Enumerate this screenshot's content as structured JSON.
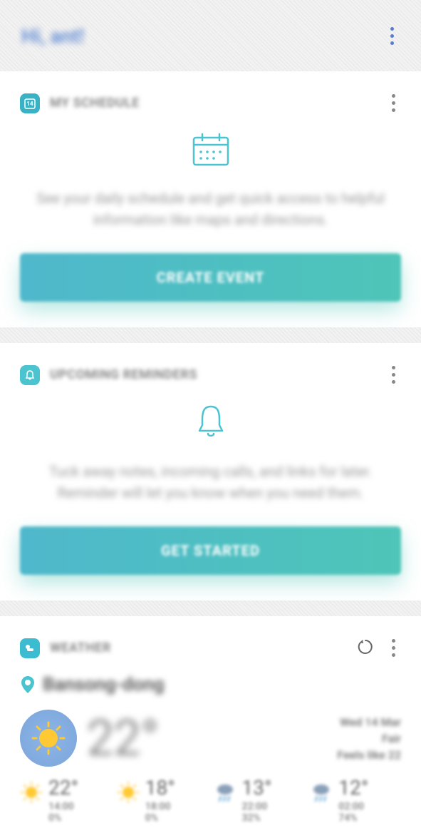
{
  "header": {
    "greeting": "Hi, ant!"
  },
  "schedule": {
    "title": "MY SCHEDULE",
    "description": "See your daily schedule and get quick access to helpful information like maps and directions.",
    "button": "CREATE EVENT"
  },
  "reminders": {
    "title": "UPCOMING REMINDERS",
    "description": "Tuck away notes, incoming calls, and links for later. Reminder will let you know when you need them.",
    "button": "GET STARTED"
  },
  "weather": {
    "title": "WEATHER",
    "location": "Bansong-dong",
    "current_temp": "22°",
    "date": "Wed 14 Mar",
    "condition": "Fair",
    "feels_like": "Feels like 22",
    "forecast": [
      {
        "temp": "22°",
        "time": "14:00",
        "precip": "0%",
        "icon": "sun"
      },
      {
        "temp": "18°",
        "time": "18:00",
        "precip": "0%",
        "icon": "sun"
      },
      {
        "temp": "13°",
        "time": "22:00",
        "precip": "32%",
        "icon": "rain"
      },
      {
        "temp": "12°",
        "time": "02:00",
        "precip": "74%",
        "icon": "rain"
      }
    ]
  }
}
